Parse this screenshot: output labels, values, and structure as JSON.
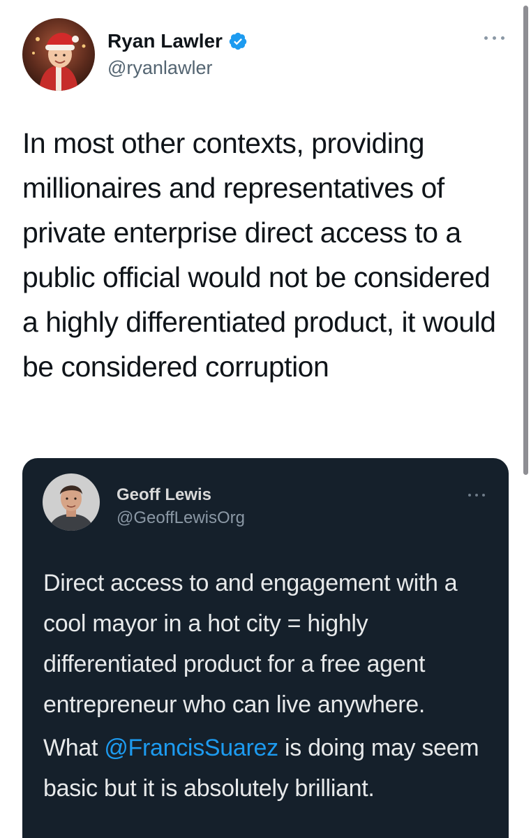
{
  "tweet": {
    "author": {
      "name": "Ryan Lawler",
      "handle": "@ryanlawler",
      "verified": true,
      "avatar_icon": "avatar-child-santa-hat"
    },
    "text": "In most other contexts, providing millionaires and representatives of private enterprise direct access to a public official would not be considered a highly differentiated product, it would be considered corruption",
    "more_icon": "more-horizontal-icon"
  },
  "quote": {
    "author": {
      "name": "Geoff Lewis",
      "handle": "@GeoffLewisOrg",
      "avatar_icon": "avatar-man-portrait"
    },
    "paragraph1": "Direct access to and engagement with a cool mayor in a hot city = highly differentiated product for a free agent entrepreneur who can live anywhere.",
    "paragraph2_prefix": "What ",
    "paragraph2_mention": "@FrancisSuarez",
    "paragraph2_suffix": " is doing may seem basic but it is absolutely brilliant.",
    "more_icon": "more-horizontal-icon"
  },
  "colors": {
    "background": "#ffffff",
    "text_primary": "#0f1419",
    "text_secondary": "#536471",
    "quote_background": "#15202b",
    "quote_text": "#e7e9ea",
    "link": "#1d9bf0",
    "verified": "#1d9bf0"
  }
}
